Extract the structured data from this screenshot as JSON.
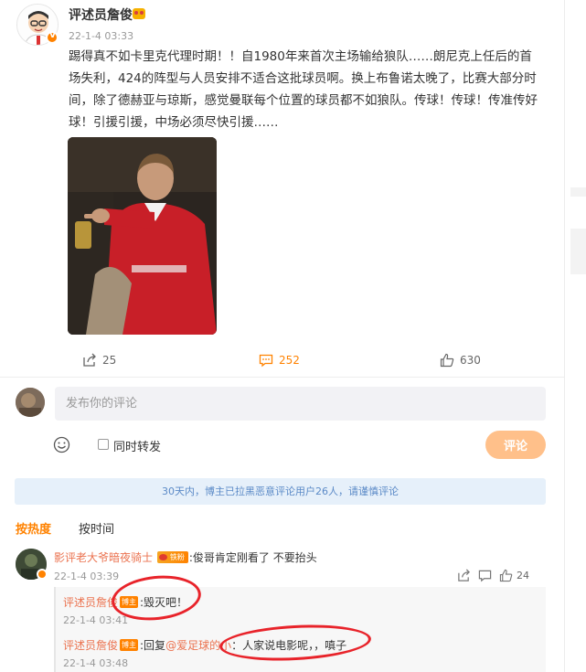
{
  "post": {
    "author": "评述员詹俊",
    "time": "22-1-4 03:33",
    "text": "踢得真不如卡里克代理时期！！自1980年来首次主场输给狼队……朗尼克上任后的首场失利，424的阵型与人员安排不适合这批球员啊。换上布鲁诺太晚了，比赛大部分时间，除了德赫亚与琼斯，感觉曼联每个位置的球员都不如狼队。传球！传球！传准传好球！引援引援，中场必须尽快引援……",
    "image_icon": "post-photo-man-pointing",
    "actions": {
      "repost": "25",
      "comment": "252",
      "like": "630"
    }
  },
  "compose": {
    "placeholder": "发布你的评论",
    "repost_label": "同时转发",
    "submit_label": "评论"
  },
  "notice": "30天内，博主已拉黑恶意评论用户26人，请谨慎评论",
  "sort": {
    "hot": "按热度",
    "time": "按时间"
  },
  "comment": {
    "user": "影评老大爷暗夜骑士",
    "fan_badge": "铁粉",
    "text": ":俊哥肯定刚看了 不要抬头",
    "time": "22-1-4 03:39",
    "like_count": "24",
    "replies": [
      {
        "user": "评述员詹俊",
        "tag": "博主",
        "text": ":毁灭吧！",
        "time": "22-1-4 03:41"
      },
      {
        "user": "评述员詹俊",
        "tag": "博主",
        "prefix": ":回复",
        "mention": "@爱足球的小",
        "text": "：人家说电影呢，，嗔子",
        "time": "22-1-4 03:48"
      }
    ]
  },
  "colors": {
    "accent": "#ff8200",
    "username": "#eb7350",
    "notice_bg": "#e6f0fa",
    "annotation": "#e8232a"
  }
}
